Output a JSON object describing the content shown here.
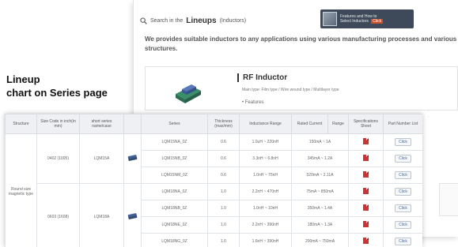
{
  "back": {
    "search_prefix": "Search in the",
    "title": "Lineups",
    "subtitle": "(Inductors)",
    "intro": "We provides suitable inductors to any applications using various manufacturing processes and various structures.",
    "rf_title": "RF Inductor",
    "rf_sub": "Main type: Film type / Wire wound type / Multilayer type",
    "rf_feature": "• Features",
    "promo_line1": "Features and How to",
    "promo_line2": "Select Inductors",
    "promo_button": "Click"
  },
  "caption": {
    "line1": "Lineup",
    "line2": "chart on Series page"
  },
  "table": {
    "headers": [
      "Structure",
      "Size Code in inch(in mm)",
      "short series name/case",
      "",
      "Series",
      "Thickness (max/mm)",
      "Inductance Range",
      "Rated Current",
      "Range",
      "Specifications Sheet",
      "Part Number List"
    ],
    "structure": "Round size magnetic type",
    "groups": [
      {
        "size": "0402 (1005)",
        "short": "LQM15A",
        "rows": [
          {
            "series": "LQM15NA_0Z",
            "thickness": "0.6",
            "inductance": "1.0uH ~ 220nH",
            "current": "150mA ~ 1A"
          },
          {
            "series": "LQM15NB_0Z",
            "thickness": "0.6",
            "inductance": "3.3nH ~ 6.8nH",
            "current": "345mA ~ 1.2A"
          },
          {
            "series": "LQM15NM_0Z",
            "thickness": "0.6",
            "inductance": "1.0nH ~ 75nH",
            "current": "520mA ~ 2.11A"
          }
        ]
      },
      {
        "size": "0603 (1608)",
        "short": "LQM18A",
        "rows": [
          {
            "series": "LQM18NA_0Z",
            "thickness": "1.0",
            "inductance": "2.2nH ~ 470nH",
            "current": "75mA ~ 850mA"
          },
          {
            "series": "LQM18NB_0Z",
            "thickness": "1.0",
            "inductance": "1.0nH ~ 10nH",
            "current": "350mA ~ 1.4A"
          },
          {
            "series": "LQM18NE_0Z",
            "thickness": "1.0",
            "inductance": "2.2nH ~ 390nH",
            "current": "180mA ~ 1.3A"
          },
          {
            "series": "LQM18NG_0Z",
            "thickness": "1.0",
            "inductance": "1.6nH ~ 390nH",
            "current": "200mA ~ 750mA"
          }
        ]
      }
    ],
    "click_label": "Click"
  }
}
